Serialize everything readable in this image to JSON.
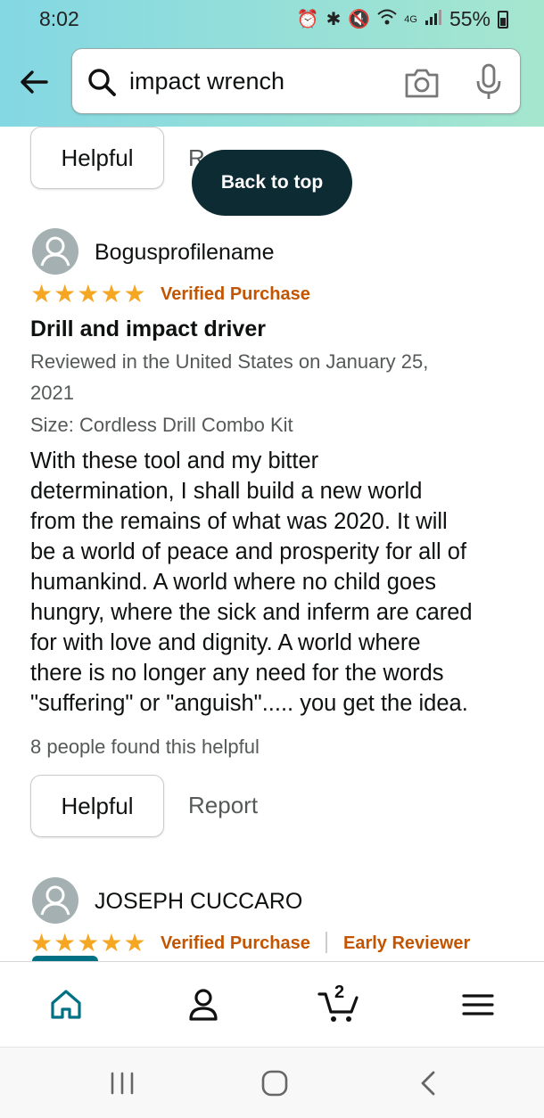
{
  "status": {
    "time": "8:02",
    "network": "4G",
    "battery_pct": "55%"
  },
  "search": {
    "value": "impact wrench"
  },
  "previous_review": {
    "helpful_label": "Helpful",
    "report_partial": "R"
  },
  "back_to_top_label": "Back to top",
  "review": {
    "reviewer": "Bogusprofilename",
    "rating": 5,
    "verified": "Verified Purchase",
    "title": "Drill and impact driver",
    "reviewed_line1": "Reviewed in the United States on January 25,",
    "reviewed_line2": "2021",
    "size": "Size: Cordless Drill Combo Kit",
    "body_lines": [
      "With these tool and my bitter",
      "determination, I shall build a new world",
      "from the remains of what was 2020. It will",
      "be a world of peace and prosperity for all of",
      "humankind. A world where no child goes",
      "hungry, where the sick and inferm are cared",
      "for with love and dignity. A world where",
      "there is no longer any need for the words",
      "\"suffering\" or \"anguish\"..... you get the idea."
    ],
    "helpful_count": "8 people found this helpful",
    "helpful_label": "Helpful",
    "report_label": "Report"
  },
  "next_review": {
    "reviewer": "JOSEPH CUCCARO",
    "rating": 5,
    "verified": "Verified Purchase",
    "badge": "Early Reviewer"
  },
  "bottom_nav": {
    "cart_count": "2",
    "items": [
      "home-icon",
      "account-icon",
      "cart-icon",
      "menu-icon"
    ]
  },
  "colors": {
    "accent": "#007185",
    "star": "#f5a623",
    "verified": "#c45500",
    "back_to_top_bg": "#0d2b33"
  }
}
